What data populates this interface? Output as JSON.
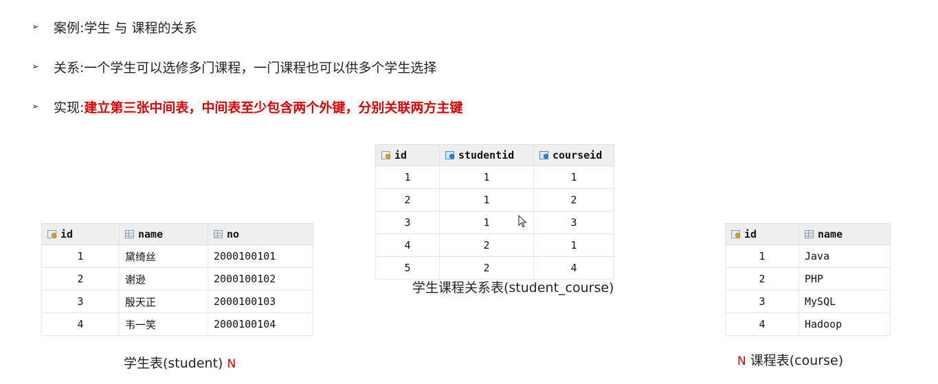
{
  "bullets": [
    {
      "marker": "➢",
      "label": "案例: ",
      "text": "学生 与 课程的关系",
      "highlight": false
    },
    {
      "marker": "➢",
      "label": "关系: ",
      "text": "一个学生可以选修多门课程，一门课程也可以供多个学生选择",
      "highlight": false
    },
    {
      "marker": "➢",
      "label": "实现: ",
      "text": "建立第三张中间表，中间表至少包含两个外键，分别关联两方主键",
      "highlight": true,
      "highlight_color": "#e00000"
    }
  ],
  "student_table": {
    "caption": "学生表(student)",
    "caption_marker": "N",
    "columns": [
      {
        "label": "id",
        "icon": "primary-key-icon"
      },
      {
        "label": "name",
        "icon": "column-icon"
      },
      {
        "label": "no",
        "icon": "column-icon"
      }
    ],
    "rows": [
      [
        "1",
        "黛绮丝",
        "2000100101"
      ],
      [
        "2",
        "谢逊",
        "2000100102"
      ],
      [
        "3",
        "殷天正",
        "2000100103"
      ],
      [
        "4",
        "韦一笑",
        "2000100104"
      ]
    ]
  },
  "student_course_table": {
    "caption": "学生课程关系表(student_course)",
    "columns": [
      {
        "label": "id",
        "icon": "primary-key-icon"
      },
      {
        "label": "studentid",
        "icon": "foreign-key-icon"
      },
      {
        "label": "courseid",
        "icon": "foreign-key-icon"
      }
    ],
    "rows": [
      [
        "1",
        "1",
        "1"
      ],
      [
        "2",
        "1",
        "2"
      ],
      [
        "3",
        "1",
        "3"
      ],
      [
        "4",
        "2",
        "1"
      ],
      [
        "5",
        "2",
        "4"
      ]
    ]
  },
  "course_table": {
    "caption": "课程表(course)",
    "caption_marker": "N",
    "columns": [
      {
        "label": "id",
        "icon": "primary-key-icon"
      },
      {
        "label": "name",
        "icon": "column-icon"
      }
    ],
    "rows": [
      [
        "1",
        "Java"
      ],
      [
        "2",
        "PHP"
      ],
      [
        "3",
        "MySQL"
      ],
      [
        "4",
        "Hadoop"
      ]
    ]
  },
  "colors": {
    "highlight": "#e00000",
    "header_bg": "#efefef",
    "marker_red": "#e00000"
  }
}
